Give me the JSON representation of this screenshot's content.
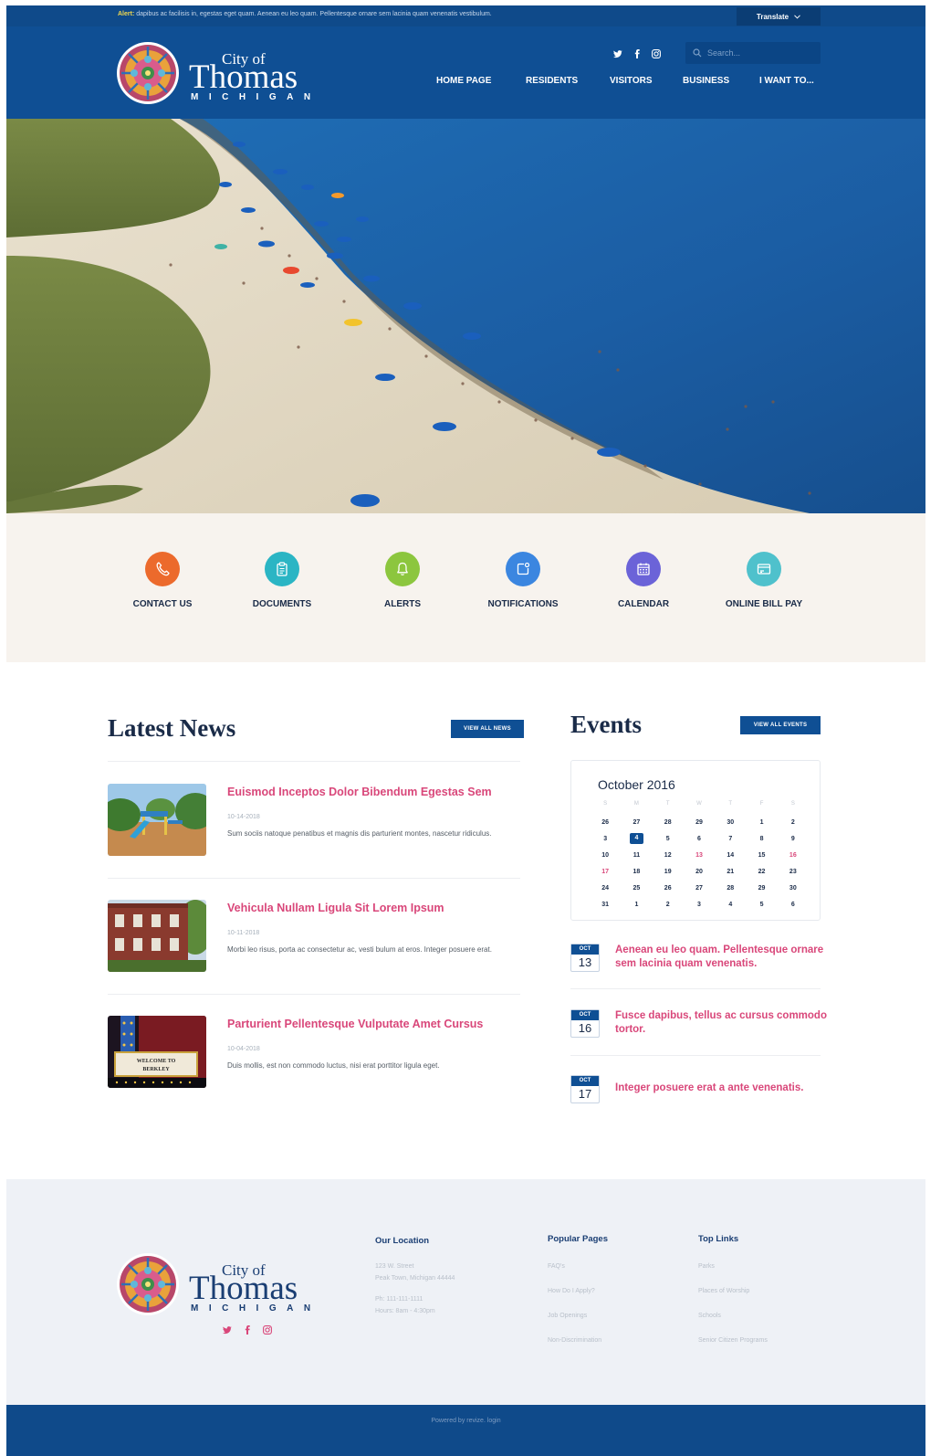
{
  "alert": {
    "label": "Alert:",
    "text": " dapibus ac facilisis in, egestas eget quam. Aenean eu leo quam. Pellentesque ornare sem lacinia quam venenatis vestibulum.",
    "translate_label": "Translate"
  },
  "logo": {
    "city_of": "City of",
    "name": "Thomas",
    "state": "MICHIGAN"
  },
  "search": {
    "placeholder": "Search..."
  },
  "nav": [
    "HOME PAGE",
    "RESIDENTS",
    "VISITORS",
    "BUSINESS",
    "I WANT TO..."
  ],
  "quick_links": [
    {
      "label": "CONTACT US",
      "icon": "phone-icon",
      "color": "#ec6a2c"
    },
    {
      "label": "DOCUMENTS",
      "icon": "clipboard-icon",
      "color": "#2bb5c4"
    },
    {
      "label": "ALERTS",
      "icon": "bell-icon",
      "color": "#8cc63e"
    },
    {
      "label": "NOTIFICATIONS",
      "icon": "notification-icon",
      "color": "#3b86e0"
    },
    {
      "label": "CALENDAR",
      "icon": "calendar-icon",
      "color": "#6b63d8"
    },
    {
      "label": "ONLINE BILL PAY",
      "icon": "bill-icon",
      "color": "#4fc1cc"
    }
  ],
  "news": {
    "title": "Latest News",
    "view_all": "VIEW ALL NEWS",
    "items": [
      {
        "title": "Euismod Inceptos Dolor Bibendum Egestas Sem",
        "date": "10-14-2018",
        "body": "Sum sociis natoque penatibus et magnis dis parturient montes, nascetur ridiculus."
      },
      {
        "title": "Vehicula Nullam Ligula Sit Lorem Ipsum",
        "date": "10-11-2018",
        "body": "Morbi leo risus, porta ac consectetur ac, vesti bulum at eros. Integer posuere erat."
      },
      {
        "title": "Parturient Pellentesque Vulputate Amet Cursus",
        "date": "10-04-2018",
        "body": "Duis mollis, est non commodo luctus, nisi erat porttitor ligula eget."
      }
    ],
    "sign_text": "WELCOME TO BERKLEY"
  },
  "events": {
    "title": "Events",
    "view_all": "VIEW ALL EVENTS",
    "calendar": {
      "month": "October 2016",
      "weekdays": [
        "S",
        "M",
        "T",
        "W",
        "T",
        "F",
        "S"
      ],
      "weeks": [
        [
          "26",
          "27",
          "28",
          "29",
          "30",
          "1",
          "2"
        ],
        [
          "3",
          "4",
          "5",
          "6",
          "7",
          "8",
          "9"
        ],
        [
          "10",
          "11",
          "12",
          "13",
          "14",
          "15",
          "16"
        ],
        [
          "17",
          "18",
          "19",
          "20",
          "21",
          "22",
          "23"
        ],
        [
          "24",
          "25",
          "26",
          "27",
          "28",
          "29",
          "30"
        ],
        [
          "31",
          "1",
          "2",
          "3",
          "4",
          "5",
          "6"
        ]
      ],
      "today": "4",
      "highlighted": [
        "13",
        "16",
        "17"
      ]
    },
    "items": [
      {
        "month": "OCT",
        "day": "13",
        "title": "Aenean eu leo quam. Pellentesque ornare sem lacinia quam venenatis."
      },
      {
        "month": "OCT",
        "day": "16",
        "title": "Fusce dapibus, tellus ac cursus commodo tortor."
      },
      {
        "month": "OCT",
        "day": "17",
        "title": "Integer posuere erat a ante venenatis."
      }
    ]
  },
  "footer": {
    "location": {
      "heading": "Our Location",
      "address1": "123 W. Street",
      "address2": "Peak Town, Michigan 44444",
      "phone": "Ph: 111-111-1111",
      "hours": "Hours: 8am - 4:30pm"
    },
    "popular": {
      "heading": "Popular Pages",
      "links": [
        "FAQ's",
        "How Do I Apply?",
        "Job Openings",
        "Non-Discrimination"
      ]
    },
    "top_links": {
      "heading": "Top Links",
      "links": [
        "Parks",
        "Places of Worship",
        "Schools",
        "Senior Citizen Programs"
      ]
    },
    "copyright": "Powered by revize. login"
  }
}
